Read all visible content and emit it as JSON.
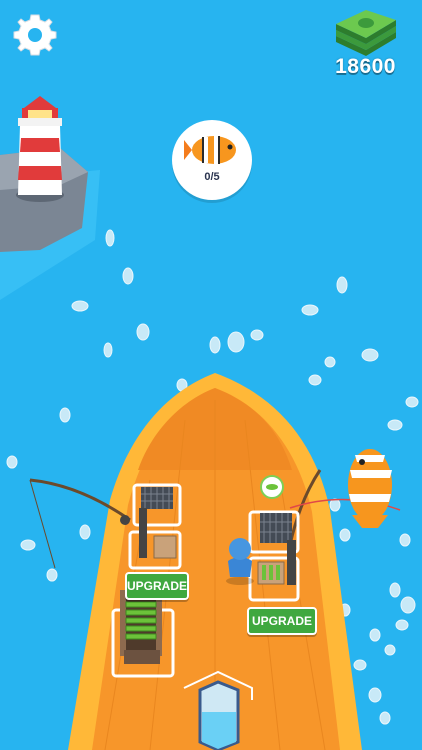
{
  "hud": {
    "settings_icon": "gear-icon",
    "cash_icon": "cash-stack-icon",
    "cash_amount": "18600"
  },
  "quest": {
    "target_icon": "clownfish-icon",
    "progress_text": "0/5",
    "progress_value": 0,
    "progress_total": 5
  },
  "stations": {
    "left_upgrade_label": "UPGRADE",
    "right_upgrade_label": "UPGRADE"
  },
  "colors": {
    "ocean": "#27b4f0",
    "boat_deck": "#f7962a",
    "boat_rim": "#ffb838",
    "upgrade_button": "#3fa83f",
    "cash": "#3c9a3c"
  }
}
